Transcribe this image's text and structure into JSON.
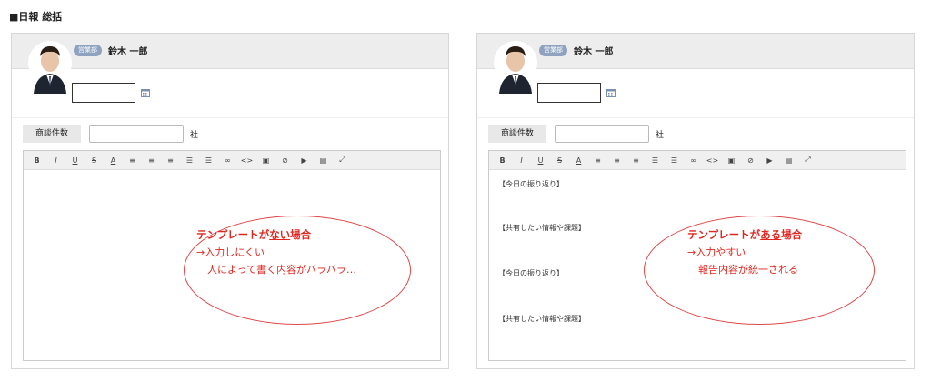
{
  "page": {
    "title": "■日報 総括"
  },
  "panels": [
    {
      "badge": "営業部",
      "user_name": "鈴木 一郎",
      "field_label": "商談件数",
      "field_unit": "社",
      "toolbar": [
        "B",
        "I",
        "U",
        "S",
        "A",
        "≡",
        "≡",
        "≡",
        "☰",
        "☰",
        "∞",
        "<>",
        "▣",
        "⊘",
        "▶",
        "▤",
        "⤢"
      ],
      "template_lines": [],
      "note": {
        "title_before": "テンプレートが",
        "title_emph": "ない",
        "title_after": "場合",
        "line1": "→入力しにくい",
        "line2": "人によって書く内容がバラバラ…"
      }
    },
    {
      "badge": "営業部",
      "user_name": "鈴木 一郎",
      "field_label": "商談件数",
      "field_unit": "社",
      "toolbar": [
        "B",
        "I",
        "U",
        "S",
        "A",
        "≡",
        "≡",
        "≡",
        "☰",
        "☰",
        "∞",
        "<>",
        "▣",
        "⊘",
        "▶",
        "▤",
        "⤢"
      ],
      "template_lines": [
        "【今日の振り返り】",
        "【共有したい情報や課題】",
        "【今日の振り返り】",
        "【共有したい情報や課題】"
      ],
      "note": {
        "title_before": "テンプレートが",
        "title_emph": "ある",
        "title_after": "場合",
        "line1": "→入力やすい",
        "line2": "報告内容が統一される"
      }
    }
  ],
  "colors": {
    "accent_red": "#e0261f",
    "badge_blue": "#8fa3c0",
    "header_gray": "#ededed"
  }
}
